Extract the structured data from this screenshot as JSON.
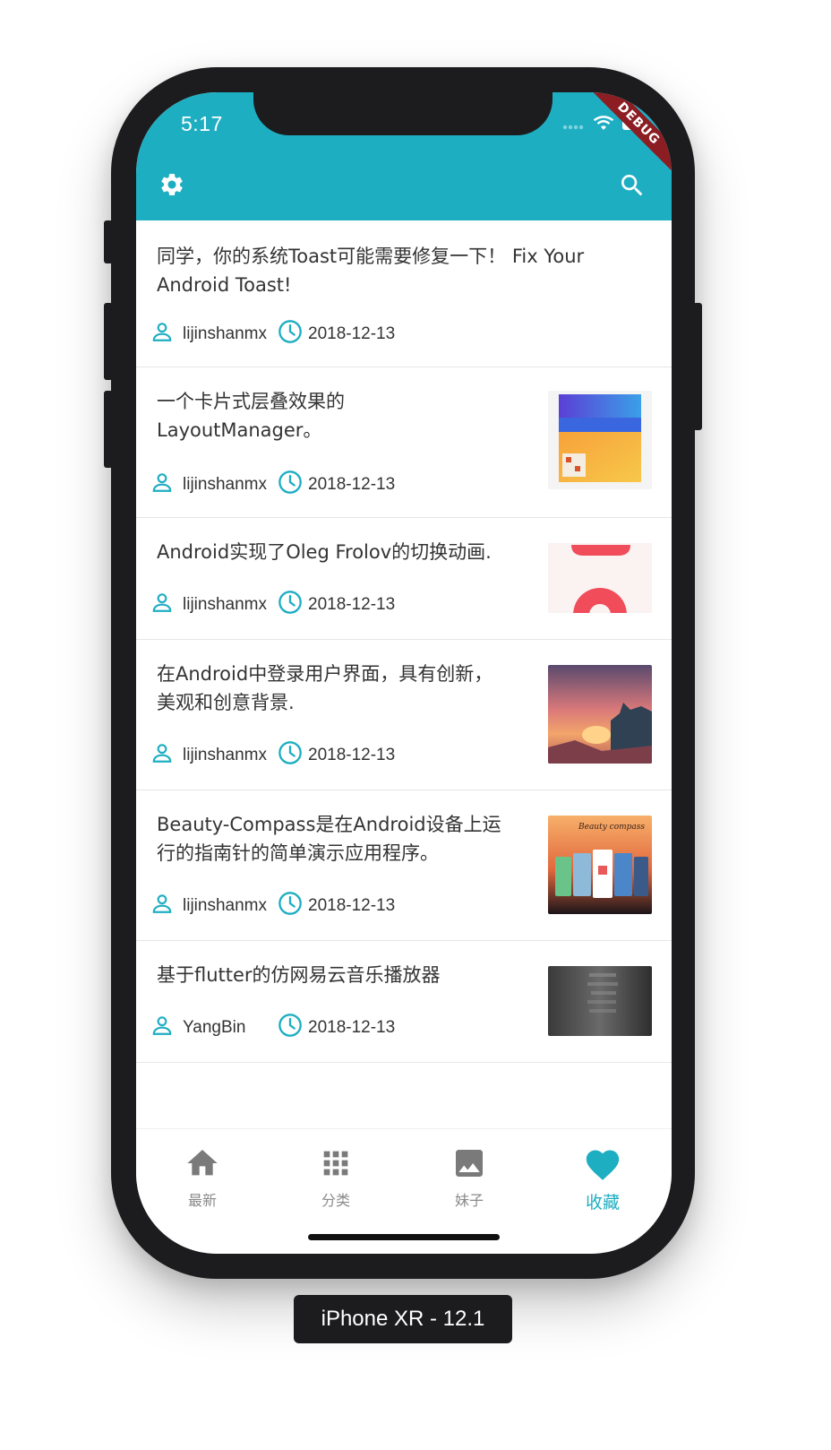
{
  "status_bar": {
    "time": "5:17",
    "debug_banner": "DEBUG"
  },
  "app_bar": {
    "left_icon": "gear-icon",
    "right_icon": "search-icon",
    "color": "#1eaec2"
  },
  "articles": [
    {
      "title_line1": "同学，你的系统Toast可能需要修复一下！ Fix Your",
      "title_line2": "Android Toast!",
      "author": "lijinshanmx",
      "date": "2018-12-13",
      "has_thumbnail": false
    },
    {
      "title_line1": "一个卡片式层叠效果的",
      "title_line2": "LayoutManager。",
      "author": "lijinshanmx",
      "date": "2018-12-13",
      "has_thumbnail": true
    },
    {
      "title_line1": "Android实现了Oleg Frolov的切换动画.",
      "title_line2": "",
      "author": "lijinshanmx",
      "date": "2018-12-13",
      "has_thumbnail": true
    },
    {
      "title_line1": "在Android中登录用户界面，具有创新，",
      "title_line2": "美观和创意背景.",
      "author": "lijinshanmx",
      "date": "2018-12-13",
      "has_thumbnail": true
    },
    {
      "title_line1": "Beauty-Compass是在Android设备上运",
      "title_line2": "行的指南针的简单演示应用程序。",
      "author": "lijinshanmx",
      "date": "2018-12-13",
      "has_thumbnail": true,
      "thumbnail_caption": "Beauty compass"
    },
    {
      "title_line1": "基于flutter的仿网易云音乐播放器",
      "title_line2": "",
      "author": "YangBin",
      "date": "2018-12-13",
      "has_thumbnail": true
    }
  ],
  "bottom_nav": {
    "items": [
      {
        "label": "最新",
        "icon": "home-icon",
        "active": false
      },
      {
        "label": "分类",
        "icon": "grid-icon",
        "active": false
      },
      {
        "label": "妹子",
        "icon": "image-icon",
        "active": false
      },
      {
        "label": "收藏",
        "icon": "heart-icon",
        "active": true
      }
    ]
  },
  "device_label": "iPhone XR - 12.1"
}
